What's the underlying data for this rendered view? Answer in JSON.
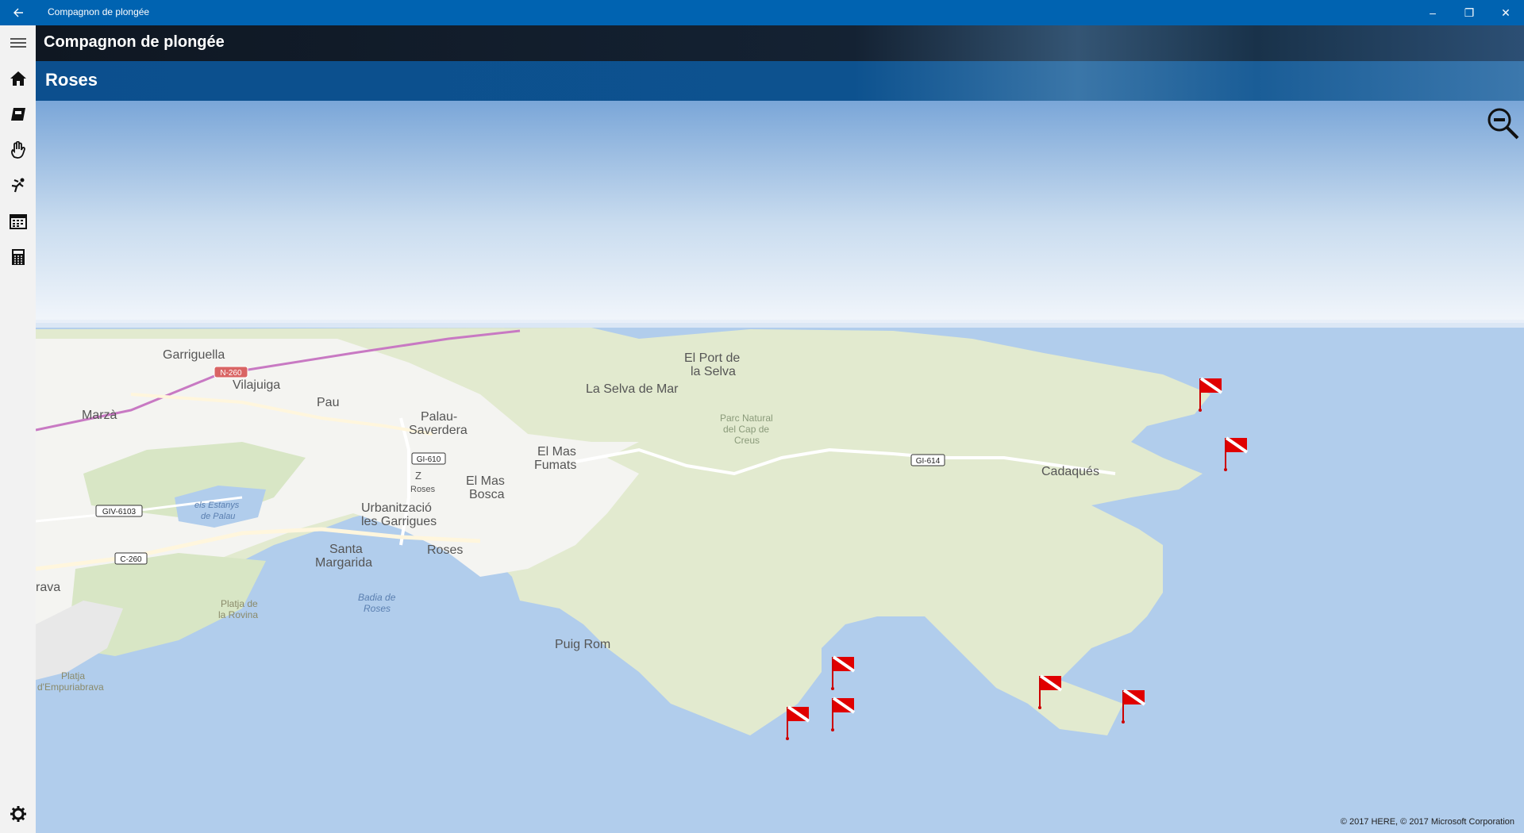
{
  "window": {
    "title": "Compagnon de plongée",
    "back_icon": "back-arrow-icon",
    "controls": {
      "minimize": "–",
      "restore": "❐",
      "close": "✕"
    }
  },
  "app": {
    "title": "Compagnon de plongée",
    "location_title": "Roses"
  },
  "nav": {
    "items": [
      {
        "name": "menu-icon"
      },
      {
        "name": "home-icon"
      },
      {
        "name": "logbook-icon"
      },
      {
        "name": "hand-signals-icon"
      },
      {
        "name": "diver-icon"
      },
      {
        "name": "calendar-icon"
      },
      {
        "name": "calculator-icon"
      }
    ],
    "settings": "gear-icon"
  },
  "map": {
    "colors": {
      "sea": "#b1cdec",
      "land": "#e2eacf",
      "urban": "#f4f4f1",
      "flag": "#e00000"
    },
    "labels": {
      "garriguella": "Garriguella",
      "vilajuiga": "Vilajuiga",
      "marza": "Marzà",
      "pau": "Pau",
      "palau1": "Palau-",
      "palau2": "Saverdera",
      "port1": "El Port de",
      "port2": "la Selva",
      "selva": "La Selva de Mar",
      "parc1": "Parc Natural",
      "parc2": "del Cap de",
      "parc3": "Creus",
      "masf1": "El Mas",
      "masf2": "Fumats",
      "masb1": "El Mas",
      "masb2": "Bosca",
      "estanys1": "els Estanys",
      "estanys2": "de Palau",
      "urb1": "Urbanització",
      "urb2": "les Garrigues",
      "santa1": "Santa",
      "santa2": "Margarida",
      "roses": "Roses",
      "roses_small": "Roses",
      "z": "Z",
      "cadaques": "Cadaqués",
      "rava": "rava",
      "platja1": "Platja de",
      "platja2": "la Rovina",
      "badia1": "Badia de",
      "badia2": "Roses",
      "puig": "Puig Rom",
      "emp1": "Platja",
      "emp2": "d'Empuriabrava"
    },
    "roads": {
      "n260": "N-260",
      "gi610": "GI-610",
      "giv6103": "GIV-6103",
      "c260": "C-260",
      "gi614": "GI-614"
    },
    "dive_site_count": 7,
    "copyright": "© 2017 HERE, © 2017 Microsoft Corporation"
  }
}
